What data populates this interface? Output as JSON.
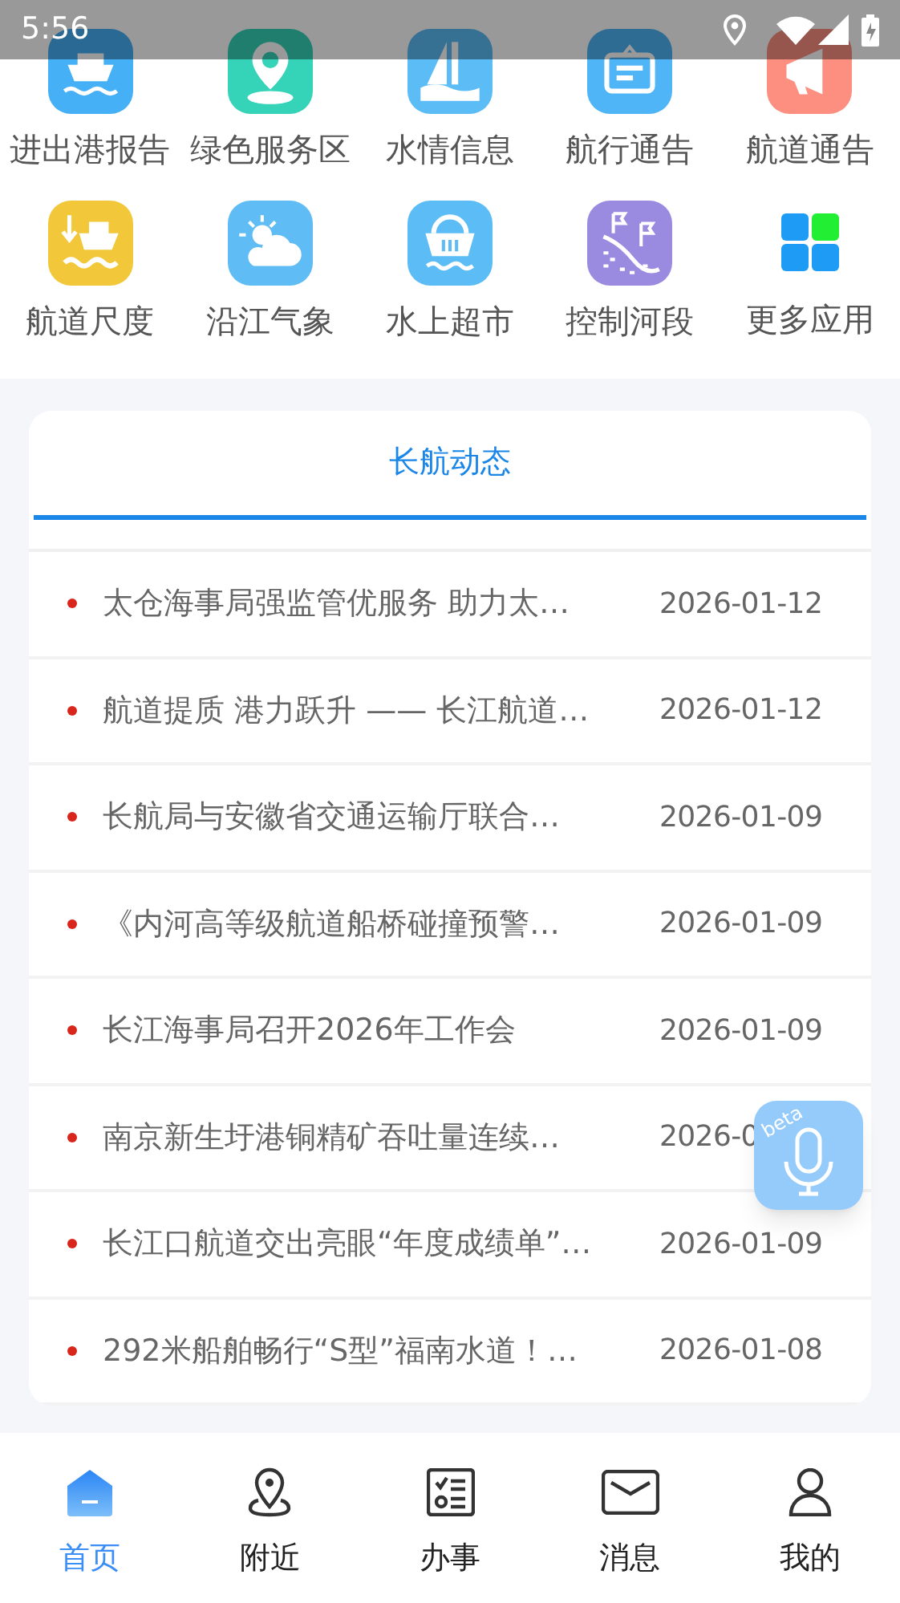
{
  "status_bar": {
    "time": "5:56"
  },
  "apps": [
    {
      "label": "进出港报告",
      "kind": "ship",
      "color": "#45b0f5"
    },
    {
      "label": "绿色服务区",
      "kind": "pin",
      "color": "#35d3b8"
    },
    {
      "label": "水情信息",
      "kind": "sail",
      "color": "#5bbcf6"
    },
    {
      "label": "航行通告",
      "kind": "notice",
      "color": "#4fb5f7"
    },
    {
      "label": "航道通告",
      "kind": "horn",
      "color": "#fc8f80"
    },
    {
      "label": "航道尺度",
      "kind": "depth",
      "color": "#f2c83a"
    },
    {
      "label": "沿江气象",
      "kind": "weather",
      "color": "#5fbcf5"
    },
    {
      "label": "水上超市",
      "kind": "basket",
      "color": "#5bbcf6"
    },
    {
      "label": "控制河段",
      "kind": "river",
      "color": "#9a8ae0"
    },
    {
      "label": "更多应用",
      "kind": "more",
      "color": "#1e9bf5"
    }
  ],
  "news_tabs": [
    {
      "label": "长航动态",
      "selected": true
    }
  ],
  "news": [
    {
      "title": "太仓海事局强监管优服务 助力太…",
      "date": "2026-01-12"
    },
    {
      "title": "航道提质  港力跃升 —— 长江航道…",
      "date": "2026-01-12"
    },
    {
      "title": "长航局与安徽省交通运输厅联合…",
      "date": "2026-01-09"
    },
    {
      "title": "《内河高等级航道船桥碰撞预警…",
      "date": "2026-01-09"
    },
    {
      "title": "长江海事局召开2026年工作会",
      "date": "2026-01-09"
    },
    {
      "title": "南京新生圩港铜精矿吞吐量连续…",
      "date": "2026-0"
    },
    {
      "title": "长江口航道交出亮眼“年度成绩单”…",
      "date": "2026-01-09"
    },
    {
      "title": "292米船舶畅行“S型”福南水道！…",
      "date": "2026-01-08"
    }
  ],
  "voice_button": {
    "badge": "beta"
  },
  "bottom_nav": [
    {
      "label": "首页",
      "kind": "home",
      "selected": true
    },
    {
      "label": "附近",
      "kind": "nearby",
      "selected": false
    },
    {
      "label": "办事",
      "kind": "tasks",
      "selected": false
    },
    {
      "label": "消息",
      "kind": "messages",
      "selected": false
    },
    {
      "label": "我的",
      "kind": "profile",
      "selected": false
    }
  ]
}
